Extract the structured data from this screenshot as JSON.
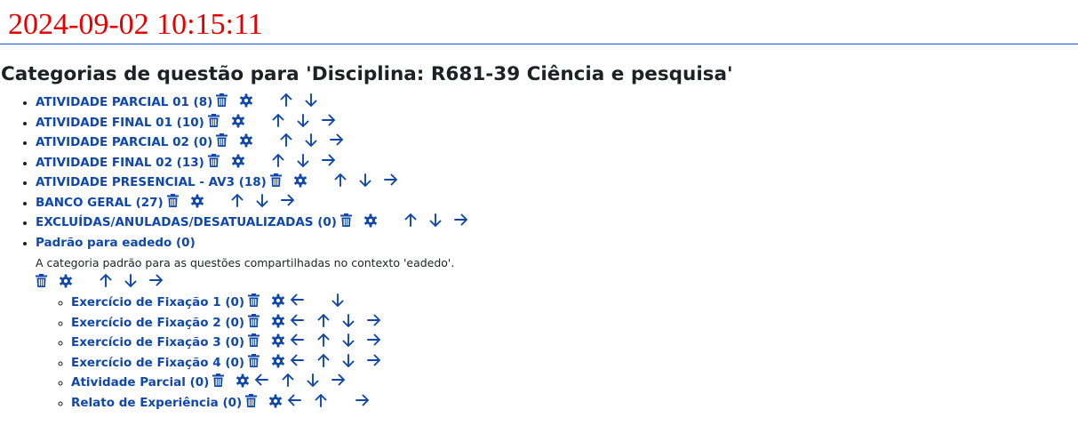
{
  "timestamp": "2024-09-02 10:15:11",
  "page_title": "Categorias de questão para 'Disciplina: R681-39 Ciência e pesquisa'",
  "colors": {
    "link": "#0f47ad",
    "timestamp": "#e60000",
    "text": "#1d2125",
    "rule": "#1f4fcf"
  },
  "icons": {
    "delete": "trash-icon",
    "edit": "gear-icon",
    "move_left": "arrow-left-icon",
    "move_up": "arrow-up-icon",
    "move_down": "arrow-down-icon",
    "move_right": "arrow-right-icon"
  },
  "categories": [
    {
      "label": "ATIVIDADE PARCIAL 01 (8)",
      "actions": [
        "delete",
        "edit",
        "up",
        "down"
      ]
    },
    {
      "label": "ATIVIDADE FINAL 01 (10)",
      "actions": [
        "delete",
        "edit",
        "up",
        "down",
        "right"
      ]
    },
    {
      "label": "ATIVIDADE PARCIAL 02 (0)",
      "actions": [
        "delete",
        "edit",
        "up",
        "down",
        "right"
      ]
    },
    {
      "label": "ATIVIDADE FINAL 02 (13)",
      "actions": [
        "delete",
        "edit",
        "up",
        "down",
        "right"
      ]
    },
    {
      "label": "ATIVIDADE PRESENCIAL - AV3 (18)",
      "actions": [
        "delete",
        "edit",
        "up",
        "down",
        "right"
      ]
    },
    {
      "label": "BANCO GERAL (27)",
      "actions": [
        "delete",
        "edit",
        "up",
        "down",
        "right"
      ]
    },
    {
      "label": "EXCLUÍDAS/ANULADAS/DESATUALIZADAS (0)",
      "actions": [
        "delete",
        "edit",
        "up",
        "down",
        "right"
      ]
    },
    {
      "label": "Padrão para eadedo (0)",
      "description": "A categoria padrão para as questões compartilhadas no contexto 'eadedo'.",
      "actions": [
        "delete",
        "edit",
        "up",
        "down",
        "right"
      ],
      "children": [
        {
          "label": "Exercício de Fixação 1 (0)",
          "actions": [
            "delete",
            "edit",
            "left",
            "down"
          ]
        },
        {
          "label": "Exercício de Fixação 2 (0)",
          "actions": [
            "delete",
            "edit",
            "left",
            "up",
            "down",
            "right"
          ]
        },
        {
          "label": "Exercício de Fixação 3 (0)",
          "actions": [
            "delete",
            "edit",
            "left",
            "up",
            "down",
            "right"
          ]
        },
        {
          "label": "Exercício de Fixação 4 (0)",
          "actions": [
            "delete",
            "edit",
            "left",
            "up",
            "down",
            "right"
          ]
        },
        {
          "label": "Atividade Parcial (0)",
          "actions": [
            "delete",
            "edit",
            "left",
            "up",
            "down",
            "right"
          ]
        },
        {
          "label": "Relato de Experiência (0)",
          "actions": [
            "delete",
            "edit",
            "left",
            "up",
            "right"
          ]
        }
      ]
    }
  ]
}
